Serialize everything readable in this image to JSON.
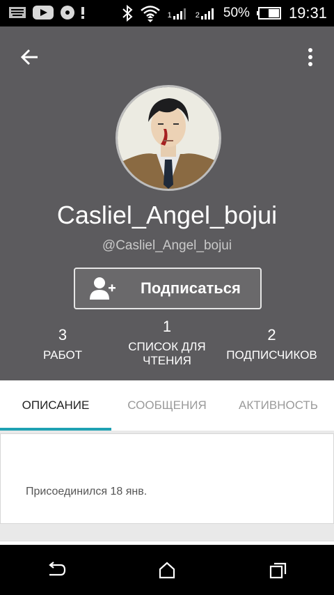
{
  "status_bar": {
    "battery_percent": "50%",
    "time": "19:31",
    "signal1_label": "1",
    "signal2_label": "2"
  },
  "profile": {
    "username": "Casliel_Angel_bojui",
    "handle": "@Casliel_Angel_bojui",
    "follow_label": "Подписаться"
  },
  "stats": [
    {
      "value": "3",
      "label": "РАБОТ"
    },
    {
      "value": "1",
      "label": "СПИСОК ДЛЯ ЧТЕНИЯ"
    },
    {
      "value": "2",
      "label": "ПОДПИСЧИКОВ"
    }
  ],
  "tabs": [
    {
      "label": "ОПИСАНИЕ",
      "active": true
    },
    {
      "label": "СООБЩЕНИЯ",
      "active": false
    },
    {
      "label": "АКТИВНОСТЬ",
      "active": false
    }
  ],
  "about": {
    "joined_text": "Присоединился 18 янв."
  },
  "colors": {
    "header_bg": "#5c5b5e",
    "tab_accent": "#1fa1b3"
  },
  "icons": {
    "back": "arrow-left-icon",
    "menu": "more-vert-icon",
    "follow": "add-person-icon",
    "nav_back": "nav-back-icon",
    "nav_home": "nav-home-icon",
    "nav_recents": "nav-recents-icon"
  }
}
